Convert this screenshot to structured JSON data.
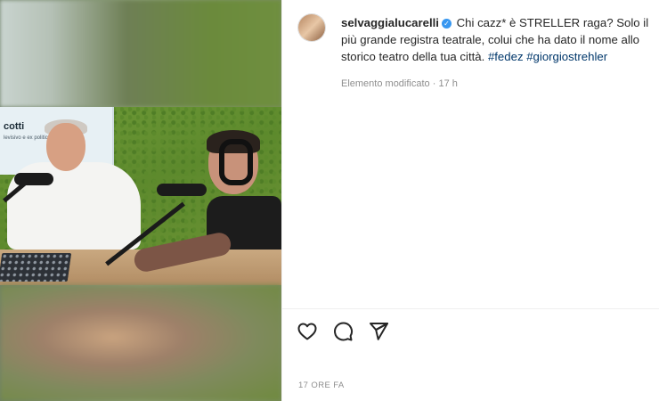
{
  "media": {
    "screen_title": "cotti",
    "screen_subtitle": "levisivo e ex politico"
  },
  "post": {
    "username": "selvaggialucarelli",
    "verified": true,
    "caption_text": "Chi cazz* è STRELLER raga? Solo il più grande registra teatrale, colui che ha dato il nome allo storico teatro della tua città.",
    "hashtags": [
      "#fedez",
      "#giorgiostrehler"
    ],
    "edited_label": "Elemento modificato",
    "separator": " · ",
    "time_short": "17 h"
  },
  "actions": {
    "like_icon": "heart-icon",
    "comment_icon": "comment-icon",
    "share_icon": "share-icon"
  },
  "footer": {
    "timestamp": "17 ORE FA"
  },
  "colors": {
    "text": "#262626",
    "muted": "#8e8e8e",
    "hashtag": "#00376b",
    "verified": "#3897f0"
  }
}
